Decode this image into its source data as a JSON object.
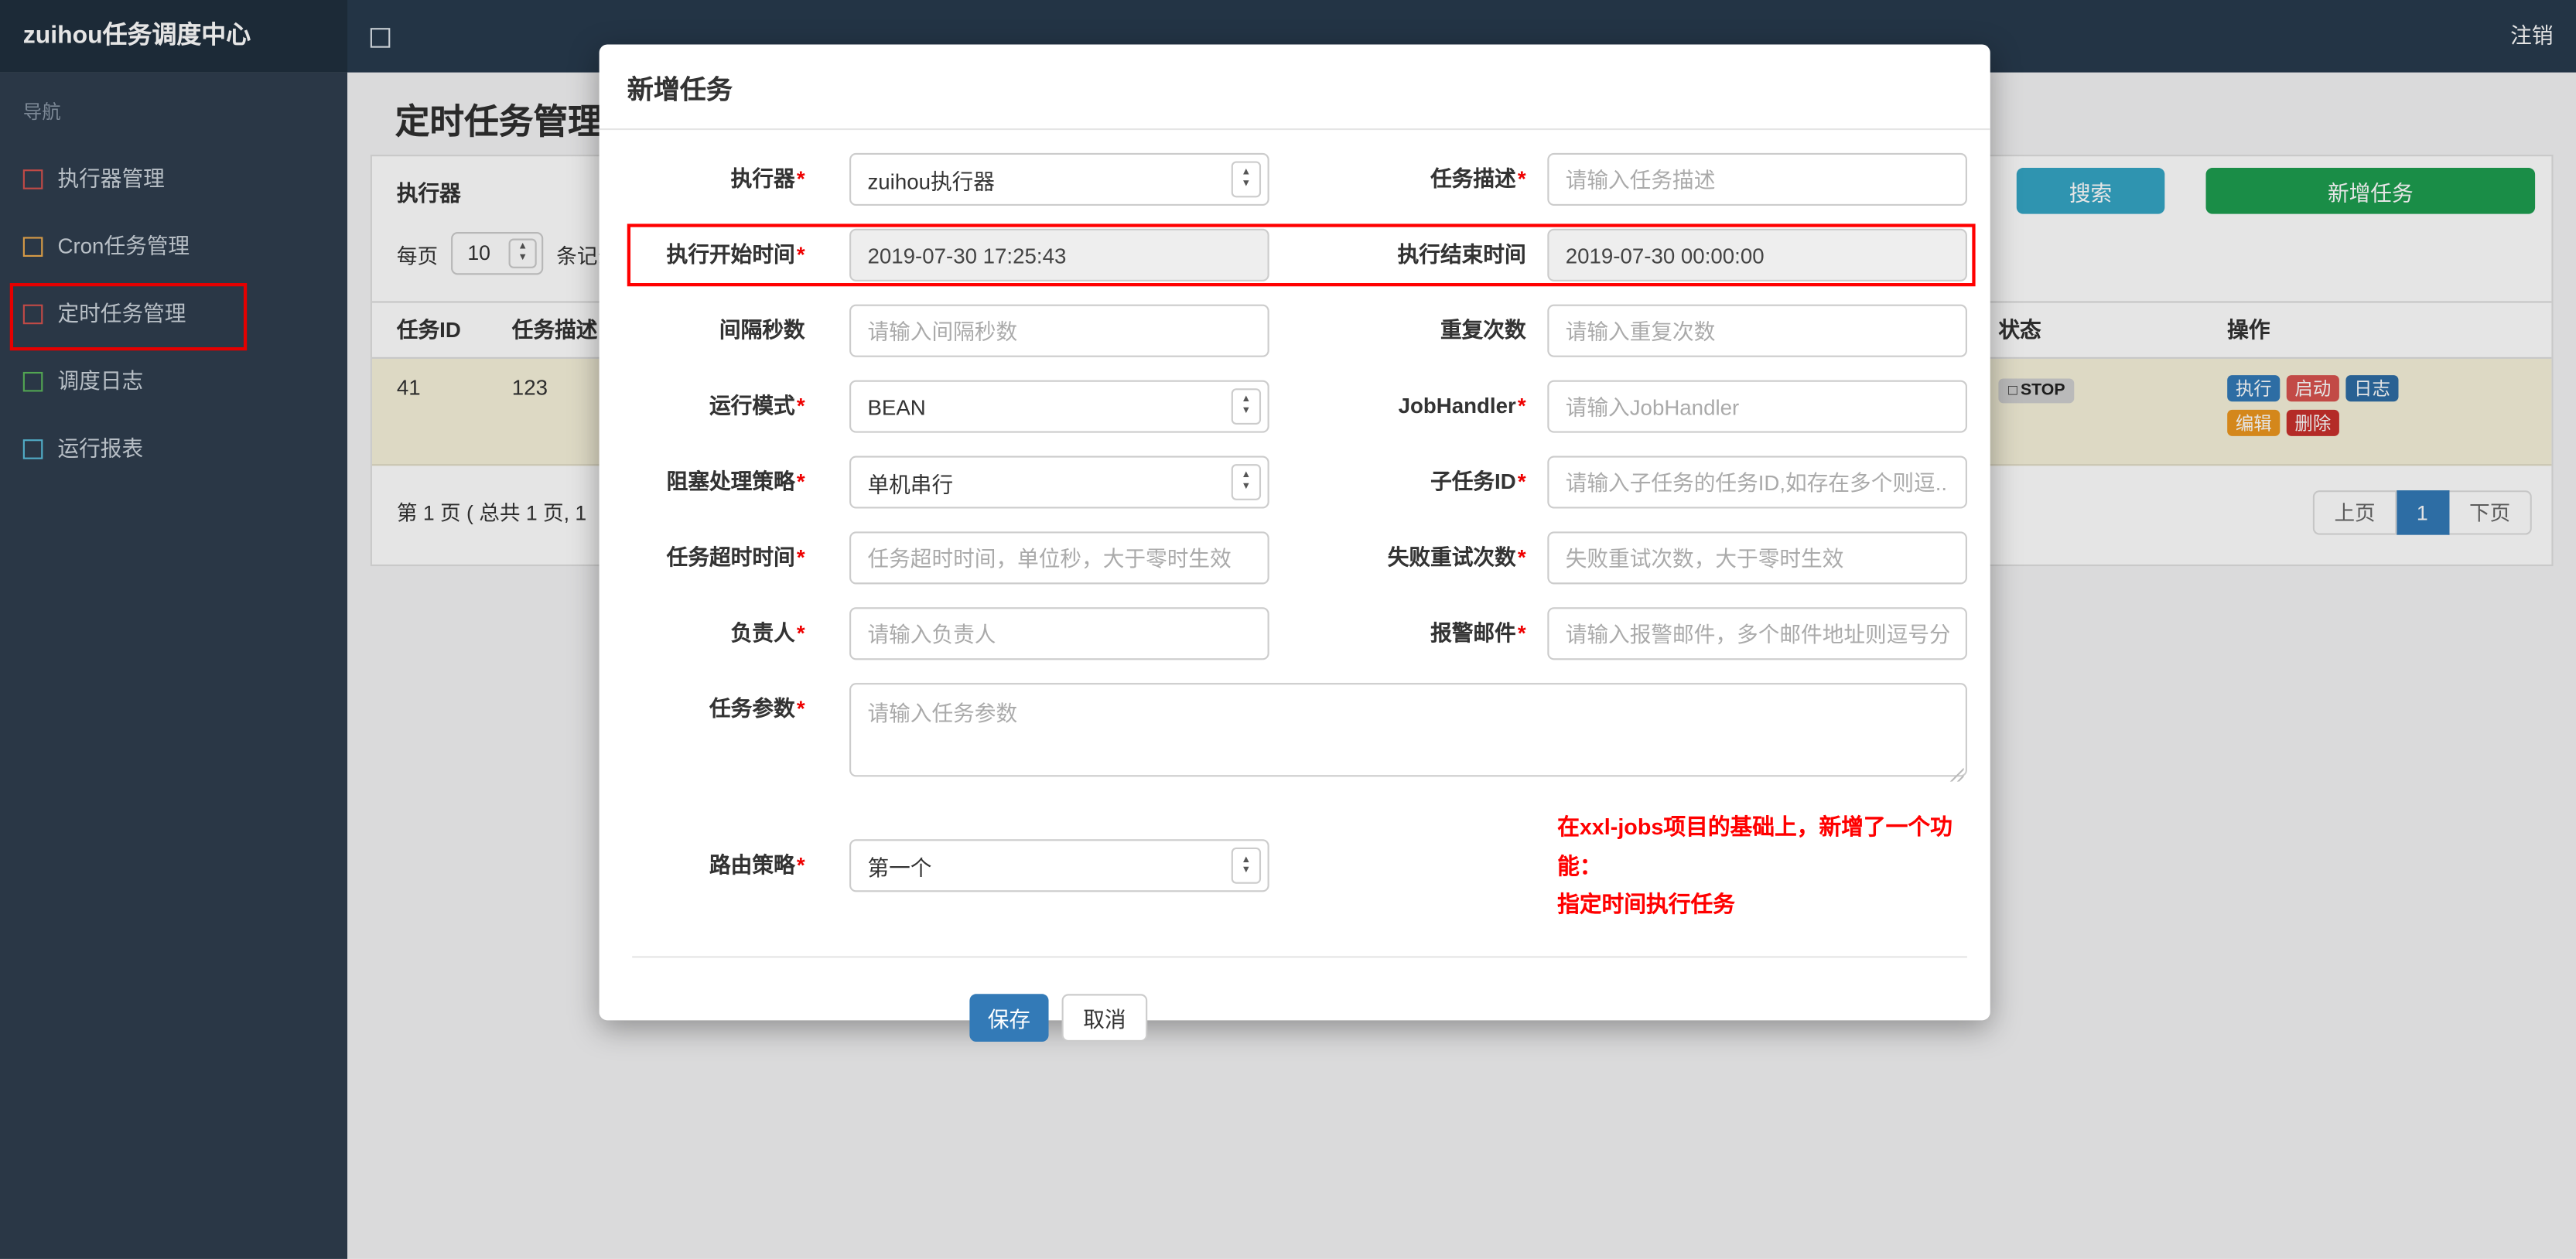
{
  "navbar": {
    "brand": "zuihou任务调度中心",
    "logout": "注销"
  },
  "icons": {
    "menu_toggle": "□",
    "select_up": "▲",
    "select_down": "▼",
    "status_square": "□"
  },
  "sidebar": {
    "nav_label": "导航",
    "items": [
      {
        "label": "执行器管理",
        "icon": "square-icon",
        "icon_color": "#d9534f",
        "active": false
      },
      {
        "label": "Cron任务管理",
        "icon": "square-icon",
        "icon_color": "#f0ad4e",
        "active": false
      },
      {
        "label": "定时任务管理",
        "icon": "square-icon",
        "icon_color": "#d9534f",
        "active": true
      },
      {
        "label": "调度日志",
        "icon": "square-icon",
        "icon_color": "#5cb85c",
        "active": false
      },
      {
        "label": "运行报表",
        "icon": "square-icon",
        "icon_color": "#5bc0de",
        "active": false
      }
    ]
  },
  "page": {
    "title": "定时任务管理",
    "filter": {
      "executor_label": "执行器",
      "search_button": "搜索",
      "add_button": "新增任务"
    },
    "per_page": {
      "prefix": "每页",
      "value": "10",
      "suffix": "条记录"
    },
    "table": {
      "headers": {
        "id": "任务ID",
        "desc": "任务描述",
        "status": "状态",
        "ops": "操作"
      },
      "row": {
        "id": "41",
        "desc": "123",
        "status": "STOP",
        "actions": [
          "执行",
          "启动",
          "日志",
          "编辑",
          "删除"
        ]
      }
    },
    "pagination": {
      "summary": "第 1 页 ( 总共 1 页, 1",
      "prev": "上页",
      "current": "1",
      "next": "下页"
    }
  },
  "modal": {
    "title": "新增任务",
    "required_mark": "*",
    "rows": [
      {
        "left": {
          "label": "执行器",
          "required": true,
          "type": "select",
          "value": "zuihou执行器"
        },
        "right": {
          "label": "任务描述",
          "required": true,
          "type": "text",
          "placeholder": "请输入任务描述"
        }
      },
      {
        "left": {
          "label": "执行开始时间",
          "required": true,
          "type": "readonly",
          "value": "2019-07-30 17:25:43"
        },
        "right": {
          "label": "执行结束时间",
          "required": false,
          "type": "readonly",
          "value": "2019-07-30 00:00:00"
        },
        "annotated": true
      },
      {
        "left": {
          "label": "间隔秒数",
          "required": false,
          "type": "text",
          "placeholder": "请输入间隔秒数"
        },
        "right": {
          "label": "重复次数",
          "required": false,
          "type": "text",
          "placeholder": "请输入重复次数"
        }
      },
      {
        "left": {
          "label": "运行模式",
          "required": true,
          "type": "select",
          "value": "BEAN"
        },
        "right": {
          "label": "JobHandler",
          "required": true,
          "type": "text",
          "placeholder": "请输入JobHandler"
        }
      },
      {
        "left": {
          "label": "阻塞处理策略",
          "required": true,
          "type": "select",
          "value": "单机串行"
        },
        "right": {
          "label": "子任务ID",
          "required": true,
          "type": "text",
          "placeholder": "请输入子任务的任务ID,如存在多个则逗..."
        }
      },
      {
        "left": {
          "label": "任务超时时间",
          "required": true,
          "type": "text",
          "placeholder": "任务超时时间，单位秒，大于零时生效"
        },
        "right": {
          "label": "失败重试次数",
          "required": true,
          "type": "text",
          "placeholder": "失败重试次数，大于零时生效"
        }
      },
      {
        "left": {
          "label": "负责人",
          "required": true,
          "type": "text",
          "placeholder": "请输入负责人"
        },
        "right": {
          "label": "报警邮件",
          "required": true,
          "type": "text",
          "placeholder": "请输入报警邮件，多个邮件地址则逗号分..."
        }
      }
    ],
    "textarea_row": {
      "label": "任务参数",
      "required": true,
      "placeholder": "请输入任务参数"
    },
    "route_row": {
      "label": "路由策略",
      "required": true,
      "value": "第一个",
      "note_line1": "在xxl-jobs项目的基础上，新增了一个功能：",
      "note_line2": "指定时间执行任务"
    },
    "footer": {
      "save": "保存",
      "cancel": "取消"
    }
  },
  "colors": {
    "navbar_bg": "#273a4d",
    "brand_bg": "#202f3e",
    "sidebar_bg": "#2f3e4e",
    "search_button": "#35a5c5",
    "add_button": "#1e9e50",
    "save_button": "#337ab7",
    "annotation_red": "#ff0000",
    "note_text": "#ff0000",
    "pagination_active": "#337ab7",
    "action_execute": "#337ab7",
    "action_start": "#d9534f",
    "action_log": "#2e6da4",
    "action_edit": "#ec971f",
    "action_delete": "#c9302c",
    "status_badge_bg": "#d0d0d0",
    "row_highlight_bg": "#f7f2db"
  }
}
